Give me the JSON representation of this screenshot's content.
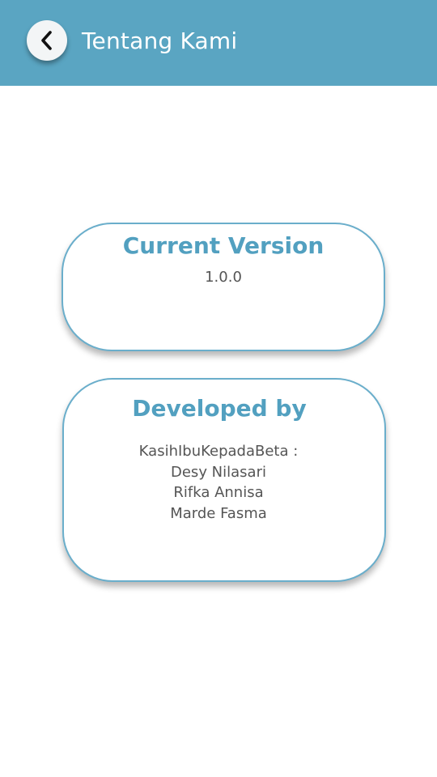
{
  "header": {
    "title": "Tentang Kami",
    "back_icon": "chevron-left-icon",
    "background_color": "#5aa5c2"
  },
  "version_card": {
    "title": "Current Version",
    "value": "1.0.0"
  },
  "developer_card": {
    "title": "Developed by",
    "lines": [
      "KasihIbuKepadaBeta :",
      "Desy Nilasari",
      "Rifka Annisa",
      "Marde Fasma"
    ]
  },
  "colors": {
    "accent": "#52a0c0",
    "card_border": "#6aaecb",
    "text": "#555555"
  }
}
